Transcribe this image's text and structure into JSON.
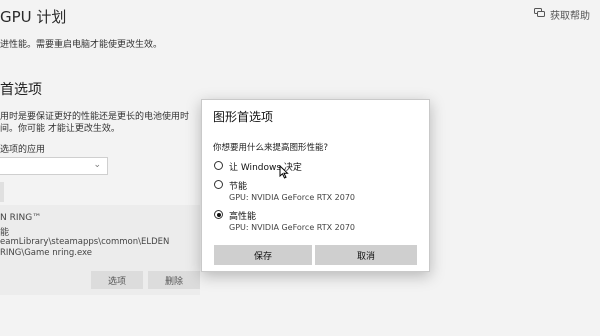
{
  "header": {
    "title": "GPU 计划",
    "help_label": "获取帮助",
    "help_icon": "chat-help-icon"
  },
  "page": {
    "description": "进性能。需要重启电脑才能使更改生效。",
    "section_title": "首选项",
    "section_description": "用时是要保证更好的性能还是更长的电池使用时间。你可能 才能让更改生效。",
    "apps_label": "选项的应用",
    "select_value": ""
  },
  "app_card": {
    "name": "N RING™",
    "mode": "能",
    "path": "eamLibrary\\steamapps\\common\\ELDEN RING\\Game nring.exe",
    "options_button": "选项",
    "delete_button": "删除"
  },
  "dialog": {
    "title": "图形首选项",
    "question": "你想要用什么来提高图形性能?",
    "options": [
      {
        "label": "让 Windows 决定",
        "sub": "",
        "selected": false
      },
      {
        "label": "节能",
        "sub": "GPU: NVIDIA GeForce RTX 2070",
        "selected": false
      },
      {
        "label": "高性能",
        "sub": "GPU: NVIDIA GeForce RTX 2070",
        "selected": true
      }
    ],
    "save_button": "保存",
    "cancel_button": "取消"
  }
}
